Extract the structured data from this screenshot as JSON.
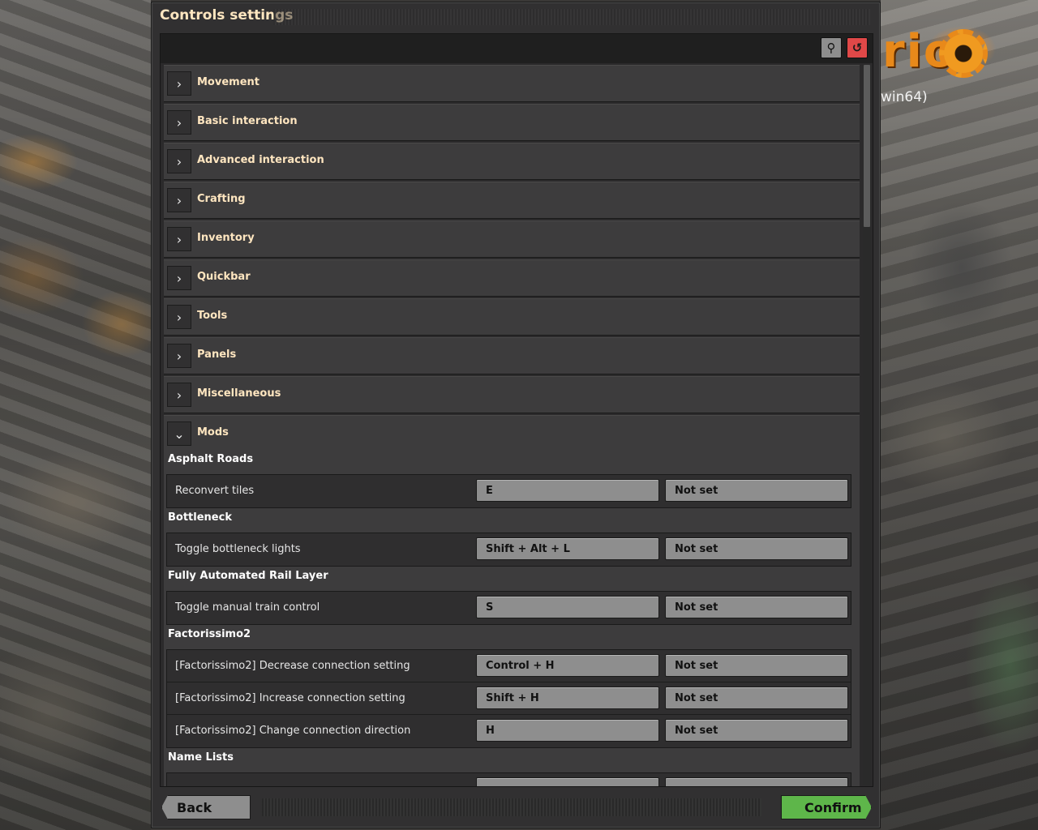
{
  "window": {
    "title": "Controls settings"
  },
  "background": {
    "logo_fragment": "rio",
    "version_fragment": "win64)"
  },
  "toolbar": {
    "search_icon": "search-icon",
    "reset_icon": "reset-icon"
  },
  "categories": [
    {
      "label": "Movement"
    },
    {
      "label": "Basic interaction"
    },
    {
      "label": "Advanced interaction"
    },
    {
      "label": "Crafting"
    },
    {
      "label": "Inventory"
    },
    {
      "label": "Quickbar"
    },
    {
      "label": "Tools"
    },
    {
      "label": "Panels"
    },
    {
      "label": "Miscellaneous"
    }
  ],
  "mods": {
    "label": "Mods",
    "expanded": true,
    "groups": [
      {
        "title": "Asphalt Roads",
        "rows": [
          {
            "label": "Reconvert tiles",
            "primary": "E",
            "secondary": "Not set"
          }
        ]
      },
      {
        "title": "Bottleneck",
        "rows": [
          {
            "label": "Toggle bottleneck lights",
            "primary": "Shift + Alt + L",
            "secondary": "Not set"
          }
        ]
      },
      {
        "title": "Fully Automated Rail Layer",
        "rows": [
          {
            "label": "Toggle manual train control",
            "primary": "S",
            "secondary": "Not set"
          }
        ]
      },
      {
        "title": "Factorissimo2",
        "rows": [
          {
            "label": "[Factorissimo2] Decrease connection setting",
            "primary": "Control + H",
            "secondary": "Not set"
          },
          {
            "label": "[Factorissimo2] Increase connection setting",
            "primary": "Shift + H",
            "secondary": "Not set"
          },
          {
            "label": "[Factorissimo2] Change connection direction",
            "primary": "H",
            "secondary": "Not set"
          }
        ]
      },
      {
        "title": "Name Lists",
        "rows": []
      }
    ]
  },
  "footer": {
    "back_label": "Back",
    "confirm_label": "Confirm"
  },
  "colors": {
    "confirm": "#5eb64a",
    "reset": "#e04848",
    "heading": "#ffe6c0"
  }
}
